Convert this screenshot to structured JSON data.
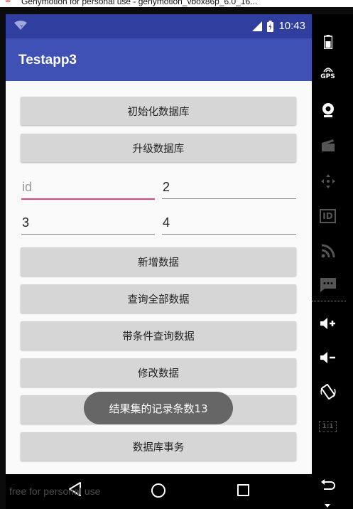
{
  "window": {
    "title": "Genymotion for personal use - genymotion_vbox86p_6.0_16..."
  },
  "status_bar": {
    "time": "10:43",
    "wifi_badge": "?"
  },
  "app": {
    "title": "Testapp3"
  },
  "buttons": {
    "init_db": "初始化数据库",
    "upgrade_db": "升级数据库",
    "add_data": "新增数据",
    "query_all": "查询全部数据",
    "query_condition": "带条件查询数据",
    "update_data": "修改数据",
    "delete_data": "",
    "transaction": "数据库事务"
  },
  "inputs": {
    "id": {
      "value": "",
      "placeholder": "id"
    },
    "field2": {
      "value": "2"
    },
    "field3": {
      "value": "3"
    },
    "field4": {
      "value": "4"
    }
  },
  "toast": {
    "text": "结果集的记录条数13"
  },
  "watermark": "free for personal use",
  "sidebar": {
    "items": [
      "battery-icon",
      "gps-icon",
      "webcam-icon",
      "video-capture-icon",
      "dpad-icon",
      "device-id-icon",
      "cast-icon",
      "sms-icon",
      "volume-up-icon",
      "volume-down-icon",
      "rotate-icon",
      "scale-icon",
      "back-icon"
    ],
    "gps_label": "GPS",
    "id_label": "ID",
    "scale_label": "1:1"
  },
  "colors": {
    "primary_dark": "#303f9f",
    "primary": "#3f51b5",
    "accent": "#ec407a",
    "button": "#d6d6d6",
    "toast": "#666666"
  }
}
